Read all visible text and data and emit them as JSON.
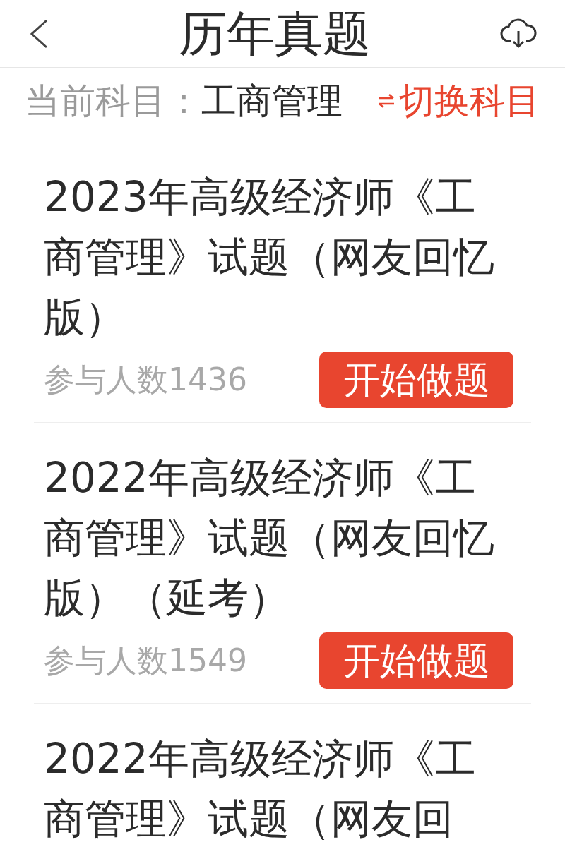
{
  "header": {
    "title": "历年真题"
  },
  "subject": {
    "label": "当前科目：",
    "value": "工商管理",
    "switch_label": "切换科目"
  },
  "papers": [
    {
      "title": "2023年高级经济师《工商管理》试题（网友回忆版）",
      "participants": "参与人数1436",
      "button": "开始做题"
    },
    {
      "title": "2022年高级经济师《工商管理》试题（网友回忆版）（延考）",
      "participants": "参与人数1549",
      "button": "开始做题"
    },
    {
      "title": "2022年高级经济师《工商管理》试题（网友回"
    }
  ]
}
